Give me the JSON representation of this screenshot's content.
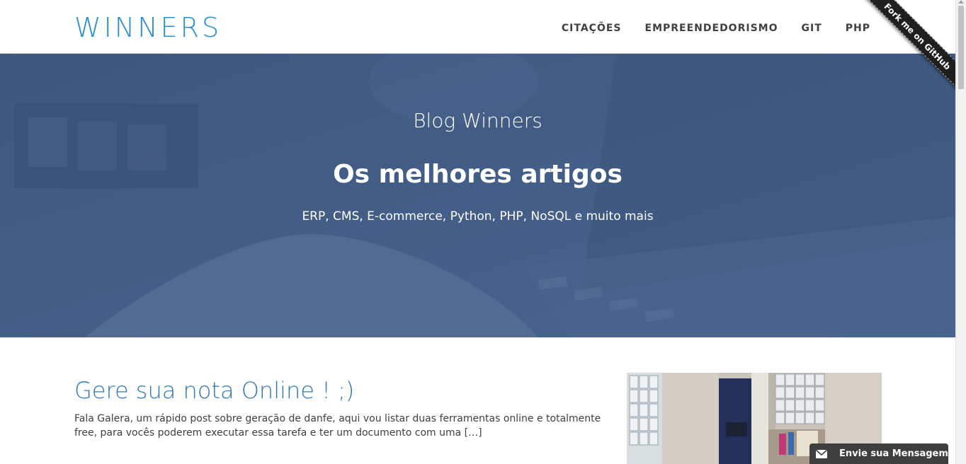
{
  "header": {
    "brand": "WINNERS",
    "nav": [
      {
        "label": "CITAÇÕES"
      },
      {
        "label": "EMPREENDEDORISMO"
      },
      {
        "label": "GIT"
      },
      {
        "label": "PHP"
      }
    ],
    "ribbon": "Fork me on GitHub"
  },
  "hero": {
    "title": "Blog Winners",
    "subtitle": "Os melhores artigos",
    "tagline": "ERP, CMS, E-commerce, Python, PHP, NoSQL e muito mais"
  },
  "post": {
    "title": "Gere sua nota Online ! ;)",
    "excerpt": "Fala Galera, um rápido post sobre geração de danfe, aqui vou listar duas ferramentas online e totalmente free, para vocês poderem executar essa tarefa e ter um documento com uma […]"
  },
  "chat": {
    "label": "Envie sua Mensagem",
    "icon": "envelope-icon"
  },
  "colors": {
    "brand": "#2a8fd0",
    "post_title": "#2d78b9",
    "hero": "#4a6285"
  }
}
